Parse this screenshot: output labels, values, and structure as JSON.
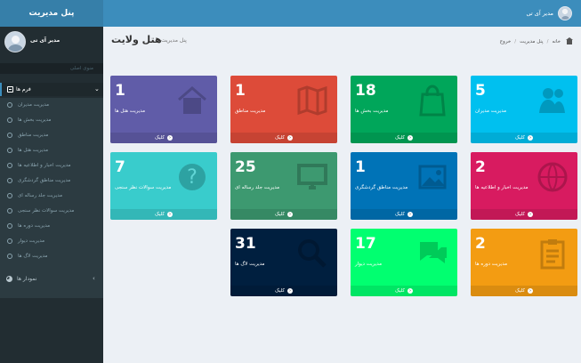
{
  "header": {
    "brand": "پنل مدیریت",
    "user_name": "مدیر آی تی"
  },
  "sidebar": {
    "user_name": "مدیر آی تی",
    "section": "منوی اصلی",
    "main_menu": "فرم ها",
    "items": [
      "مدیریت مدیران",
      "مدیریت بخش ها",
      "مدیریت مناطق",
      "مدیریت هتل ها",
      "مدیریت اخبار و اطلاعیه ها",
      "مدیریت مناطق گردشگری",
      "مدیریت جلد رساله ای",
      "مدیریت سوالات نظر سنجی",
      "مدیریت دوره ها",
      "مدیریت دیوار",
      "مدیریت لاگ ها"
    ],
    "charts_menu": "نمودار ها"
  },
  "page": {
    "title": "هتل ولایت",
    "subtitle": "پنل مدیریت",
    "breadcrumb": [
      "خانه",
      "پنل مدیریت",
      "خروج"
    ]
  },
  "boxes": [
    {
      "value": "5",
      "title": "مدیریت مدیران",
      "link": "کلیک",
      "color": "#00c0ef",
      "icon": "users-icon"
    },
    {
      "value": "18",
      "title": "مدیریت بخش ها",
      "link": "کلیک",
      "color": "#00a65a",
      "icon": "shopping-bag-icon"
    },
    {
      "value": "1",
      "title": "مدیریت مناطق",
      "link": "کلیک",
      "color": "#dd4b39",
      "icon": "map-icon"
    },
    {
      "value": "1",
      "title": "مدیریت هتل ها",
      "link": "کلیک",
      "color": "#605ca8",
      "icon": "home-icon"
    },
    {
      "value": "2",
      "title": "مدیریت اخبار و اطلاعیه ها",
      "link": "کلیک",
      "color": "#d81b60",
      "icon": "globe-icon"
    },
    {
      "value": "1",
      "title": "مدیریت مناطق گردشگری",
      "link": "کلیک",
      "color": "#0073b7",
      "icon": "image-icon"
    },
    {
      "value": "25",
      "title": "مدیریت جلد رساله ای",
      "link": "کلیک",
      "color": "#3d9970",
      "icon": "monitor-icon"
    },
    {
      "value": "7",
      "title": "مدیریت سوالات نظر سنجی",
      "link": "کلیک",
      "color": "#39cccc",
      "icon": "question-icon"
    },
    {
      "value": "2",
      "title": "مدیریت دوره ها",
      "link": "کلیک",
      "color": "#f39c12",
      "icon": "clipboard-icon"
    },
    {
      "value": "17",
      "title": "مدیریت دیوار",
      "link": "کلیک",
      "color": "#01ff70",
      "icon": "comments-icon"
    },
    {
      "value": "31",
      "title": "مدیریت لاگ ها",
      "link": "کلیک",
      "color": "#001f3f",
      "icon": "search-icon"
    }
  ]
}
